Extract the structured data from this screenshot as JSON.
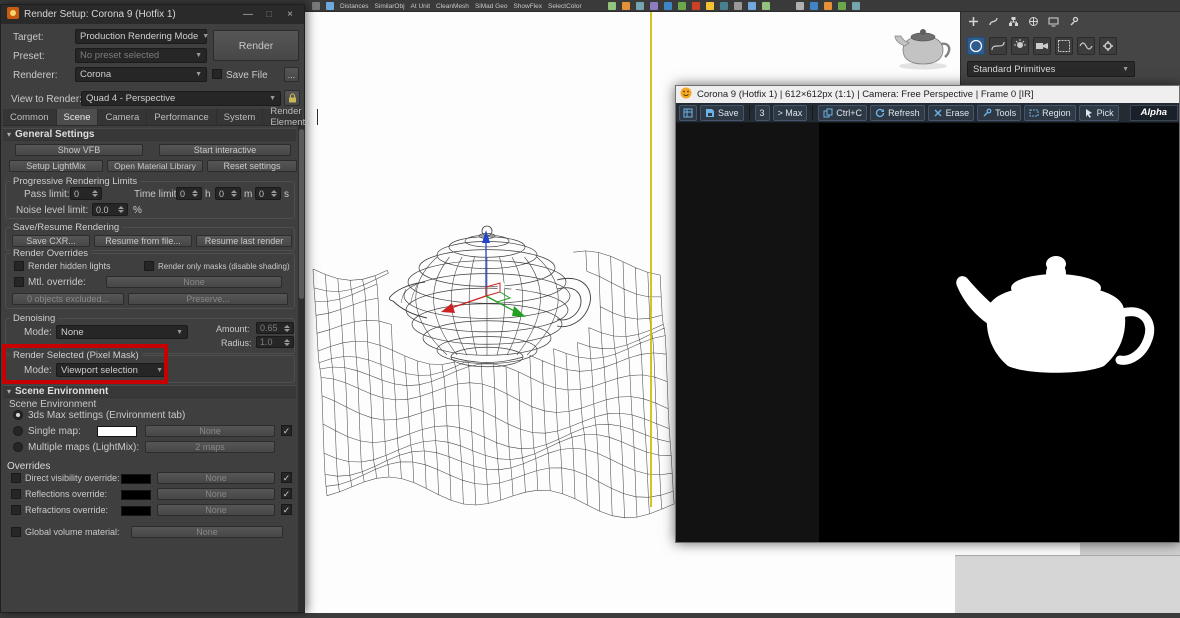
{
  "icons": {
    "dropdown_arrow": "▼",
    "rollout_arrow": "▾",
    "checkmark": "✓",
    "minimize": "—",
    "maximize": "□",
    "close": "×"
  },
  "top_toolbar": {
    "script_labels": [
      "Distances",
      "SimilarObj",
      "At Unit",
      "CleanMesh",
      "SiMad Geo",
      "ShowFlex",
      "SelectColor"
    ]
  },
  "dialog": {
    "title": "Render Setup: Corona 9 (Hotfix 1)",
    "target_label": "Target:",
    "target_value": "Production Rendering Mode",
    "preset_label": "Preset:",
    "preset_value": "No preset selected",
    "renderer_label": "Renderer:",
    "renderer_value": "Corona",
    "save_file_label": "Save File",
    "browse_label": "...",
    "render_button": "Render",
    "view_label": "View to Render:",
    "view_value": "Quad 4 - Perspective",
    "tabs": [
      "Common",
      "Scene",
      "Camera",
      "Performance",
      "System",
      "Render Elements"
    ],
    "general_header": "General Settings",
    "show_vfb": "Show VFB",
    "start_interactive": "Start interactive",
    "setup_lightmix": "Setup LightMix",
    "open_material_library": "Open Material Library",
    "reset_settings": "Reset settings",
    "progressive_header": "Progressive Rendering Limits",
    "pass_limit_label": "Pass limit:",
    "pass_limit_value": "0",
    "time_limit_label": "Time limit:",
    "time_h_value": "0",
    "time_h_unit": "h",
    "time_m_value": "0",
    "time_m_unit": "m",
    "time_s_value": "0",
    "time_s_unit": "s",
    "noise_label": "Noise level limit:",
    "noise_value": "0.0",
    "noise_unit": "%",
    "save_resume_header": "Save/Resume Rendering",
    "save_cxr": "Save CXR...",
    "resume_from_file": "Resume from file...",
    "resume_last_render": "Resume last render",
    "render_overrides_header": "Render Overrides",
    "render_hidden_lights": "Render hidden lights",
    "render_only_masks": "Render only masks (disable shading)",
    "mtl_override_label": "Mtl. override:",
    "mtl_override_value": "None",
    "objects_excluded": "0 objects excluded...",
    "preserve": "Preserve...",
    "denoising_header": "Denoising",
    "denoise_mode_label": "Mode:",
    "denoise_mode_value": "None",
    "amount_label": "Amount:",
    "amount_value": "0.65",
    "radius_label": "Radius:",
    "radius_value": "1.0",
    "render_selected_header": "Render Selected (Pixel Mask)",
    "rs_mode_label": "Mode:",
    "rs_mode_value": "Viewport selection",
    "scene_env_header": "Scene Environment",
    "scene_env_label": "Scene Environment",
    "max_settings_label": "3ds Max settings (Environment tab)",
    "single_map_label": "Single map:",
    "single_map_value": "None",
    "multiple_maps_label": "Multiple maps (LightMix):",
    "multiple_maps_value": "2 maps",
    "overrides_header": "Overrides",
    "direct_visibility_label": "Direct visibility override:",
    "direct_visibility_value": "None",
    "reflections_label": "Reflections override:",
    "reflections_value": "None",
    "refractions_label": "Refractions override:",
    "refractions_value": "None",
    "global_volume_label": "Global volume material:",
    "global_volume_value": "None"
  },
  "vfb": {
    "title": "Corona 9 (Hotfix 1) | 612×612px (1:1) | Camera: Free Perspective | Frame 0 [IR]",
    "save": "Save",
    "stops": "3",
    "to_max": "> Max",
    "copy": "Ctrl+C",
    "refresh": "Refresh",
    "erase": "Erase",
    "tools": "Tools",
    "region": "Region",
    "pick": "Pick",
    "channel": "Alpha"
  },
  "command_panel": {
    "category_dropdown": "Standard Primitives"
  }
}
